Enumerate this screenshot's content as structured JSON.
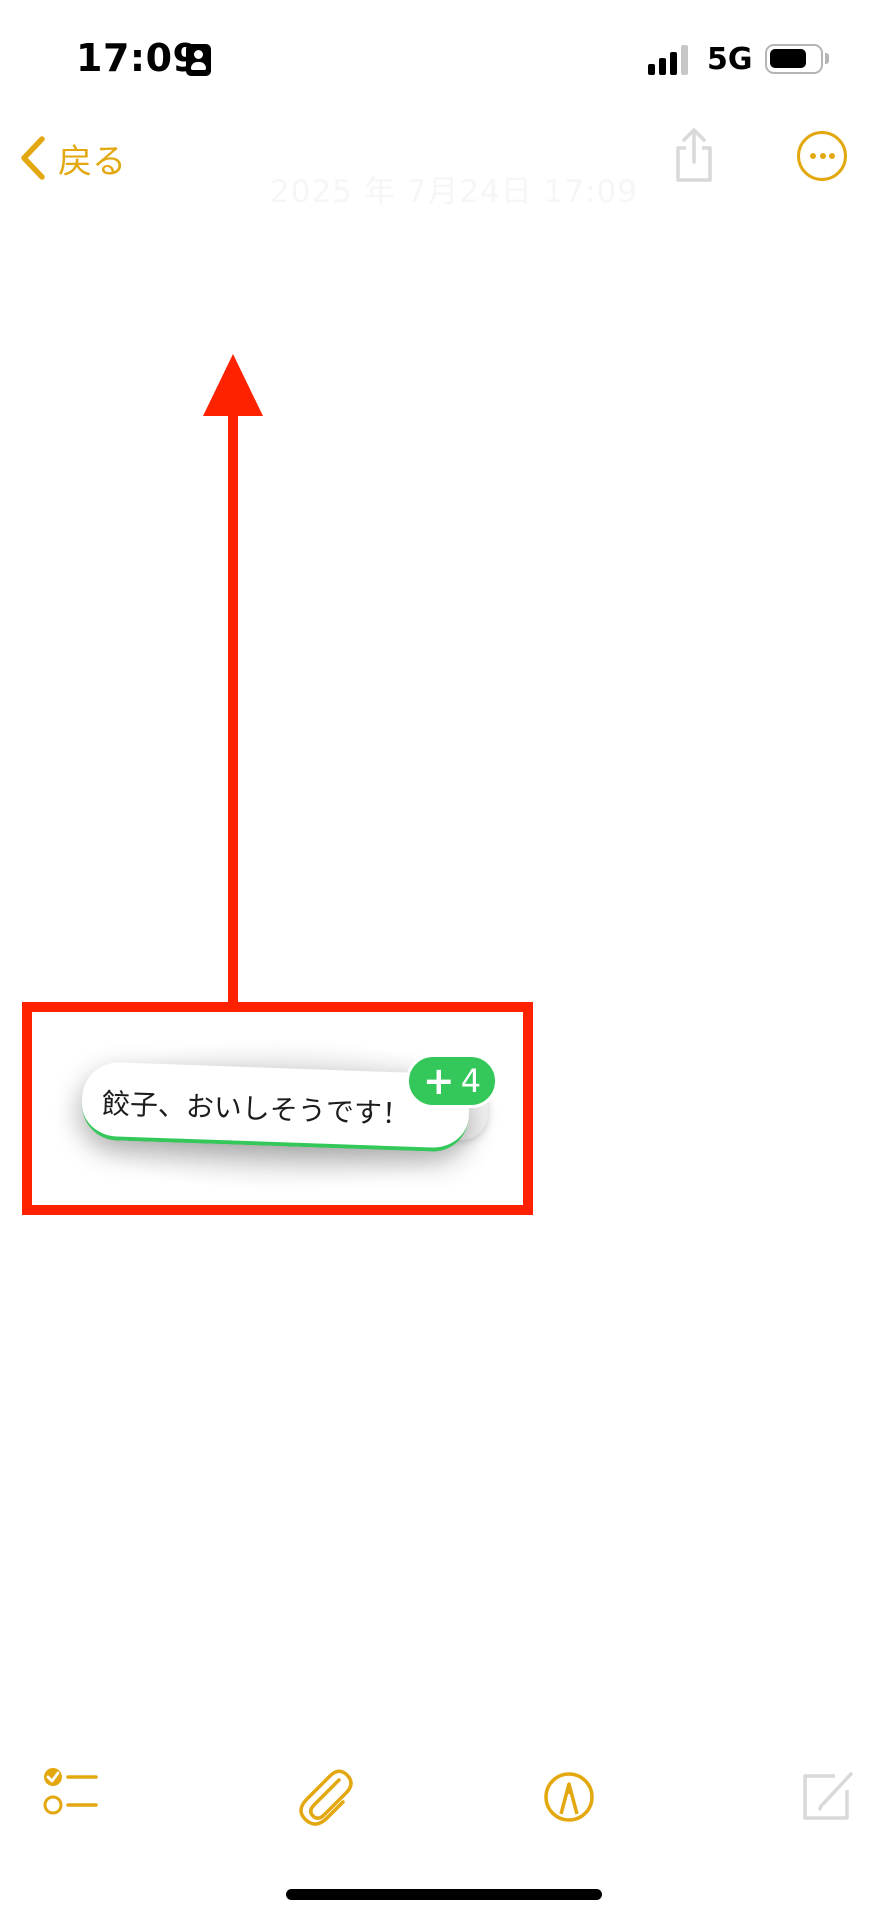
{
  "status_bar": {
    "time": "17:09",
    "network": "5G",
    "battery_level": 0.75,
    "signal_bars_filled": 3,
    "signal_bars_total": 4,
    "icons": [
      "person-id-icon",
      "signal-icon",
      "battery-icon"
    ]
  },
  "nav": {
    "back_label": "戻る",
    "date_text": "2025 年 7月24日 17:09",
    "icons": [
      "chevron-left-icon",
      "share-icon",
      "ellipsis-circle-icon"
    ]
  },
  "drag_preview": {
    "text": "餃子、おいしそうです！",
    "badge_count": "4",
    "badge_symbol": "+"
  },
  "toolbar": {
    "icons": [
      "checklist-icon",
      "paperclip-icon",
      "markup-pen-icon",
      "compose-icon"
    ]
  },
  "colors": {
    "accent": "#e3a810",
    "annotation": "#ff2200",
    "badge": "#34c759",
    "disabled_icon": "#d9d9d9"
  }
}
